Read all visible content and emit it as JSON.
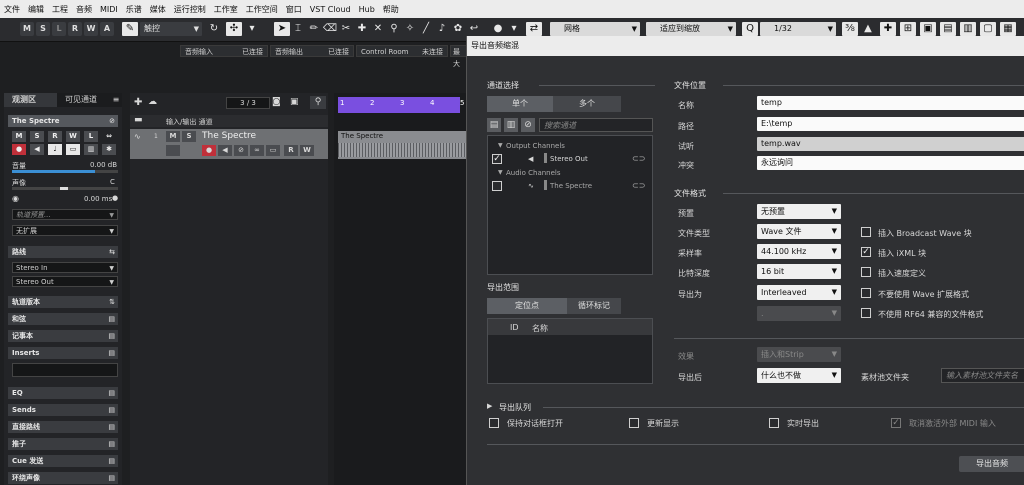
{
  "menubar": [
    "文件",
    "编辑",
    "工程",
    "音频",
    "MIDI",
    "乐谱",
    "媒体",
    "运行控制",
    "工作室",
    "工作空间",
    "窗口",
    "VST Cloud",
    "Hub",
    "帮助"
  ],
  "toolbar": {
    "mode_buttons": [
      "M",
      "S",
      "L",
      "R",
      "W",
      "A"
    ],
    "automation_mode": "触控",
    "snap_type": "网格",
    "quantize_mode": "适应到缩放",
    "quantize_value": "1/32"
  },
  "statusbar": {
    "audio_input_label": "音频输入",
    "audio_input_status": "已连接",
    "audio_output_label": "音频输出",
    "audio_output_status": "已连接",
    "control_room_label": "Control Room",
    "control_room_status": "未连接",
    "extra": "最大"
  },
  "inspector": {
    "tabs": [
      "观测区",
      "可见通道"
    ],
    "track_name": "The Spectre",
    "volume_label": "音量",
    "volume_value": "0.00 dB",
    "pan_label": "声像",
    "pan_value": "C",
    "delay_value": "0.00 ms",
    "track_preset_placeholder": "轨道预置...",
    "expansion": "无扩展",
    "routing_label": "路线",
    "routing_in": "Stereo In",
    "routing_out": "Stereo Out",
    "sections": [
      "轨道版本",
      "和弦",
      "记事本",
      "Inserts",
      "EQ",
      "Sends",
      "直接路线",
      "推子",
      "Cue 发送",
      "环绕声像"
    ],
    "buttons": [
      "M",
      "S",
      "R",
      "W",
      "L"
    ]
  },
  "tracklist": {
    "counter": "3 / 3",
    "folder_name": "输入/输出 通道",
    "track_number": "1",
    "track_name": "The Spectre",
    "track_buttons": [
      "M",
      "S",
      "R",
      "W"
    ]
  },
  "arrange": {
    "ruler_marks": [
      "1",
      "2",
      "3",
      "4",
      "5"
    ],
    "event_name": "The Spectre"
  },
  "dialog": {
    "title": "导出音频缩混",
    "channel_section": "通道选择",
    "channel_tabs": [
      "单个",
      "多个"
    ],
    "search_placeholder": "搜索通道",
    "output_group": "Output Channels",
    "output_channel": "Stereo Out",
    "audio_group": "Audio Channels",
    "audio_channel": "The Spectre",
    "range_section": "导出范围",
    "range_tabs": [
      "定位点",
      "循环标记"
    ],
    "range_columns": [
      "ID",
      "名称"
    ],
    "file_location_section": "文件位置",
    "name_label": "名称",
    "name_value": "temp",
    "path_label": "路径",
    "path_value": "E:\\temp",
    "preview_label": "试听",
    "preview_value": "temp.wav",
    "conflict_label": "冲突",
    "conflict_value": "永远询问",
    "file_format_section": "文件格式",
    "preset_label": "预置",
    "preset_value": "无预置",
    "file_type_label": "文件类型",
    "file_type_value": "Wave 文件",
    "sample_rate_label": "采样率",
    "sample_rate_value": "44.100 kHz",
    "bit_depth_label": "比特深度",
    "bit_depth_value": "16 bit",
    "export_as_label": "导出为",
    "export_as_value": "Interleaved",
    "extra_select_value": ".",
    "check_broadcast": "插入 Broadcast Wave 块",
    "check_ixml": "插入 iXML 块",
    "check_tempo": "插入速度定义",
    "check_no_wave_ext": "不要使用 Wave 扩展格式",
    "check_no_rf64": "不使用 RF64 兼容的文件格式",
    "effects_label": "效果",
    "effects_value": "插入和Strip",
    "after_export_label": "导出后",
    "after_export_value": "什么也不做",
    "pool_folder_label": "素材池文件夹",
    "pool_folder_placeholder": "输入素材池文件夹名",
    "queue_label": "导出队列",
    "keep_open": "保持对话框打开",
    "update_display": "更新显示",
    "realtime_export": "实时导出",
    "deactivate_midi": "取消激活外部 MIDI 输入",
    "export_button": "导出音频",
    "checkmark": "✓"
  }
}
